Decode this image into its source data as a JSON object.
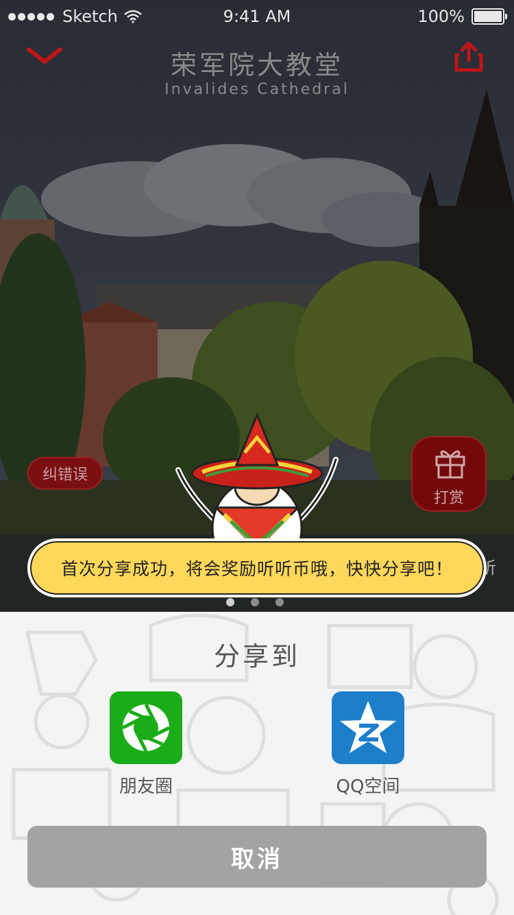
{
  "status_bar": {
    "carrier": "Sketch",
    "time": "9:41 AM",
    "battery": "100%"
  },
  "header": {
    "title_cn": "荣军院大教堂",
    "title_en": "Invalides Cathedral",
    "back_icon": "chevron-down-icon",
    "share_icon": "share-icon"
  },
  "actions": {
    "correct_label": "纠错误",
    "reward_label": "打赏",
    "listen_partial": "听"
  },
  "toast": {
    "message": "首次分享成功，将会奖励听听币哦，快快分享吧！"
  },
  "carousel": {
    "page_count": 3,
    "active_index": 0
  },
  "share_sheet": {
    "title": "分享到",
    "targets": [
      {
        "label": "朋友圈",
        "color": "#1aad19",
        "icon": "moments-icon"
      },
      {
        "label": "QQ空间",
        "color": "#1d7fca",
        "icon": "qzone-icon"
      }
    ],
    "cancel_label": "取消"
  },
  "colors": {
    "accent_red": "#c0141b",
    "toast_yellow": "#ffd75a",
    "cancel_gray": "#a3a3a3"
  }
}
